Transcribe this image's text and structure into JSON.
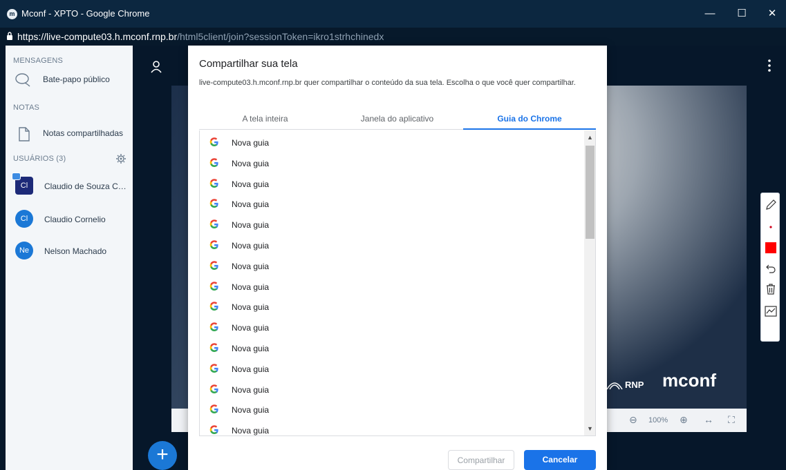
{
  "window": {
    "title": "Mconf - XPTO - Google Chrome",
    "url_host": "https://live-compute03.h.mconf.rnp.br",
    "url_path": "/html5client/join?sessionToken=ikro1strhchinedx",
    "minimize_icon": "minimize-icon",
    "maximize_icon": "maximize-icon",
    "close_icon": "close-icon"
  },
  "sidebar": {
    "messages_title": "MENSAGENS",
    "public_chat": "Bate-papo público",
    "notes_title": "NOTAS",
    "shared_notes": "Notas compartilhadas",
    "users_title": "USUÁRIOS (3)",
    "users": [
      {
        "initials": "Cl",
        "name": "Claudio de Souza Cor..."
      },
      {
        "initials": "Cl",
        "name": "Claudio Cornelio"
      },
      {
        "initials": "Ne",
        "name": "Nelson Machado"
      }
    ]
  },
  "presentation": {
    "rnp_logo": "RNP",
    "mconf_logo": "mconf",
    "zoom_out": "⊖",
    "zoom_level": "100%",
    "zoom_in": "⊕",
    "fit_width": "↔",
    "fullscreen": "⛶",
    "add_button": "+"
  },
  "dialog": {
    "title": "Compartilhar sua tela",
    "description": "live-compute03.h.mconf.rnp.br quer compartilhar o conteúdo da sua tela. Escolha o que você quer compartilhar.",
    "tabs": [
      "A tela inteira",
      "Janela do aplicativo",
      "Guia do Chrome"
    ],
    "active_tab": "Guia do Chrome",
    "items": [
      "Nova guia",
      "Nova guia",
      "Nova guia",
      "Nova guia",
      "Nova guia",
      "Nova guia",
      "Nova guia",
      "Nova guia",
      "Nova guia",
      "Nova guia",
      "Nova guia",
      "Nova guia",
      "Nova guia",
      "Nova guia",
      "Nova guia"
    ],
    "share_label": "Compartilhar",
    "cancel_label": "Cancelar"
  },
  "colors": {
    "accent": "#1a73e8",
    "titlebar": "#0c2740",
    "background": "#06172a"
  }
}
